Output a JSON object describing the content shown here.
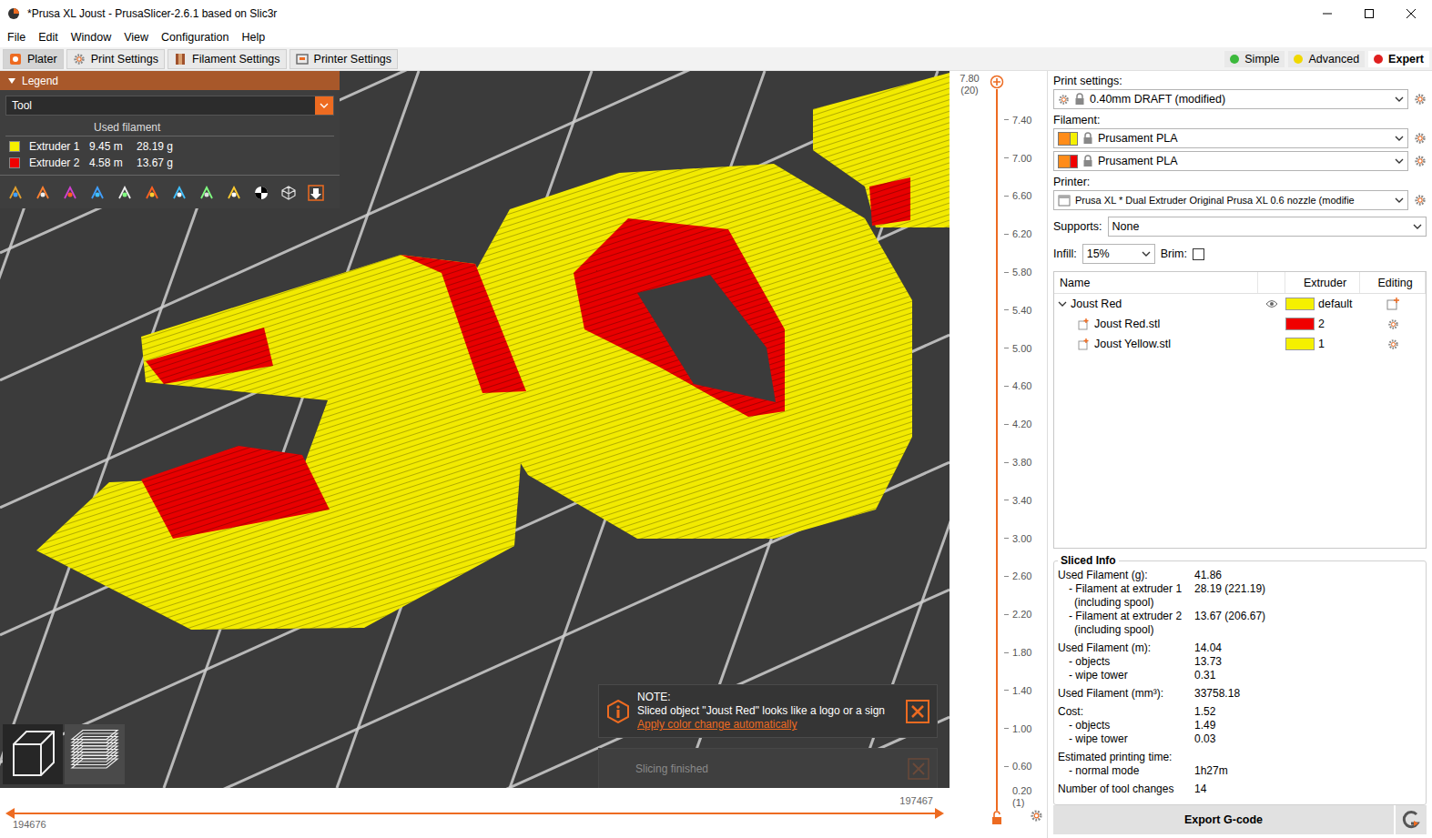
{
  "window": {
    "title": "*Prusa XL Joust - PrusaSlicer-2.6.1 based on Slic3r"
  },
  "menu": [
    "File",
    "Edit",
    "Window",
    "View",
    "Configuration",
    "Help"
  ],
  "tabs": [
    {
      "label": "Plater",
      "selected": true
    },
    {
      "label": "Print Settings",
      "selected": false
    },
    {
      "label": "Filament Settings",
      "selected": false
    },
    {
      "label": "Printer Settings",
      "selected": false
    }
  ],
  "modes": [
    {
      "label": "Simple",
      "selected": false,
      "color": "#3cb93c"
    },
    {
      "label": "Advanced",
      "selected": false,
      "color": "#f0d800"
    },
    {
      "label": "Expert",
      "selected": true,
      "color": "#e02020"
    }
  ],
  "legend": {
    "title": "Legend",
    "expanded": true,
    "view": "Tool",
    "header": "Used filament",
    "extruders": [
      {
        "name": "Extruder 1",
        "length": "9.45 m",
        "weight": "28.19 g",
        "color": "#f5f000"
      },
      {
        "name": "Extruder 2",
        "length": "4.58 m",
        "weight": "13.67 g",
        "color": "#f00000"
      }
    ]
  },
  "notifications": [
    {
      "title": "NOTE:",
      "text": "Sliced object \"Joust Red\" looks like a logo or a sign",
      "link": "Apply color change automatically"
    }
  ],
  "faded_notification": {
    "text": "Slicing finished"
  },
  "vertical_slider": {
    "top_value": "7.80",
    "top_layer": "(20)",
    "bottom_value": "0.20",
    "bottom_layer": "(1)",
    "ticks": [
      "7.40",
      "7.00",
      "6.60",
      "6.20",
      "5.80",
      "5.40",
      "5.00",
      "4.60",
      "4.20",
      "3.80",
      "3.40",
      "3.00",
      "2.60",
      "2.20",
      "1.80",
      "1.40",
      "1.00",
      "0.60"
    ]
  },
  "horizontal_slider": {
    "left": "194676",
    "right": "197467"
  },
  "sidebar": {
    "print_settings": {
      "label": "Print settings:",
      "value": "0.40mm DRAFT (modified)"
    },
    "filament": {
      "label": "Filament:",
      "items": [
        {
          "value": "Prusament PLA",
          "color": "#f5f000"
        },
        {
          "value": "Prusament PLA",
          "color": "#f00000"
        }
      ]
    },
    "printer": {
      "label": "Printer:",
      "value": "Prusa XL * Dual Extruder Original Prusa XL 0.6 nozzle (modifie"
    },
    "supports": {
      "label": "Supports:",
      "value": "None"
    },
    "infill": {
      "label": "Infill:",
      "value": "15%"
    },
    "brim": {
      "label": "Brim:",
      "checked": false
    }
  },
  "object_list": {
    "columns": [
      "Name",
      "Extruder",
      "Editing"
    ],
    "rows": [
      {
        "name": "Joust Red",
        "kind": "object",
        "expanded": true,
        "visible": true,
        "extruder": "default",
        "color": "#f5f000"
      },
      {
        "name": "Joust Red.stl",
        "kind": "part",
        "expanded": false,
        "visible": false,
        "extruder": "2",
        "color": "#f00000"
      },
      {
        "name": "Joust Yellow.stl",
        "kind": "part",
        "expanded": false,
        "visible": false,
        "extruder": "1",
        "color": "#f5f000"
      }
    ]
  },
  "sliced_info": {
    "title": "Sliced Info",
    "groups": [
      {
        "rows": [
          {
            "label": [
              "Used Filament (g):"
            ],
            "value": "41.86",
            "kind": "total"
          },
          {
            "label": [
              "- Filament at extruder 1",
              "(including spool)"
            ],
            "value": "28.19 (221.19)",
            "kind": "detail"
          },
          {
            "label": [
              "- Filament at extruder 2",
              "(including spool)"
            ],
            "value": "13.67 (206.67)",
            "kind": "detail"
          }
        ]
      },
      {
        "rows": [
          {
            "label": [
              "Used Filament (m):"
            ],
            "value": "14.04",
            "kind": "total"
          },
          {
            "label": [
              "- objects"
            ],
            "value": "13.73",
            "kind": "detail"
          },
          {
            "label": [
              "- wipe tower"
            ],
            "value": "0.31",
            "kind": "detail"
          }
        ]
      },
      {
        "rows": [
          {
            "label": [
              "Used Filament (mm³):"
            ],
            "value": "33758.18",
            "kind": "total"
          }
        ]
      },
      {
        "rows": [
          {
            "label": [
              "Cost:"
            ],
            "value": "1.52",
            "kind": "total"
          },
          {
            "label": [
              "- objects"
            ],
            "value": "1.49",
            "kind": "detail"
          },
          {
            "label": [
              "- wipe tower"
            ],
            "value": "0.03",
            "kind": "detail"
          }
        ]
      },
      {
        "rows": [
          {
            "label": [
              "Estimated printing time:"
            ],
            "value": "",
            "kind": "total"
          },
          {
            "label": [
              "- normal mode"
            ],
            "value": "1h27m",
            "kind": "detail"
          }
        ]
      },
      {
        "rows": [
          {
            "label": [
              "Number of tool changes"
            ],
            "value": "14",
            "kind": "total"
          }
        ]
      }
    ]
  },
  "export_button": {
    "label": "Export G-code"
  }
}
